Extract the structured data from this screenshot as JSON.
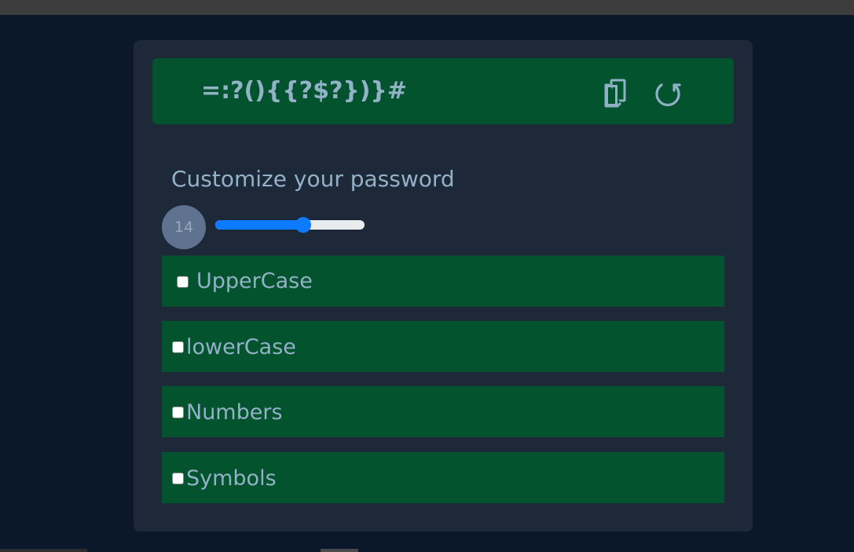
{
  "password": {
    "value": "=:?(){{?$?})}#",
    "copy_icon": "copy-icon",
    "refresh_icon": "refresh-icon"
  },
  "customize": {
    "title": "Customize your password"
  },
  "length": {
    "value": "14",
    "slider_fraction": 0.59
  },
  "options": [
    {
      "label": "UpperCase",
      "checked": false
    },
    {
      "label": "lowerCase",
      "checked": false
    },
    {
      "label": "Numbers",
      "checked": false
    },
    {
      "label": "Symbols",
      "checked": false
    }
  ],
  "colors": {
    "background": "#0b172b",
    "card": "#1d2838",
    "accent_green": "#02532e",
    "text": "#93b1c7",
    "slider": "#0d7bff",
    "badge": "#5f7390"
  }
}
